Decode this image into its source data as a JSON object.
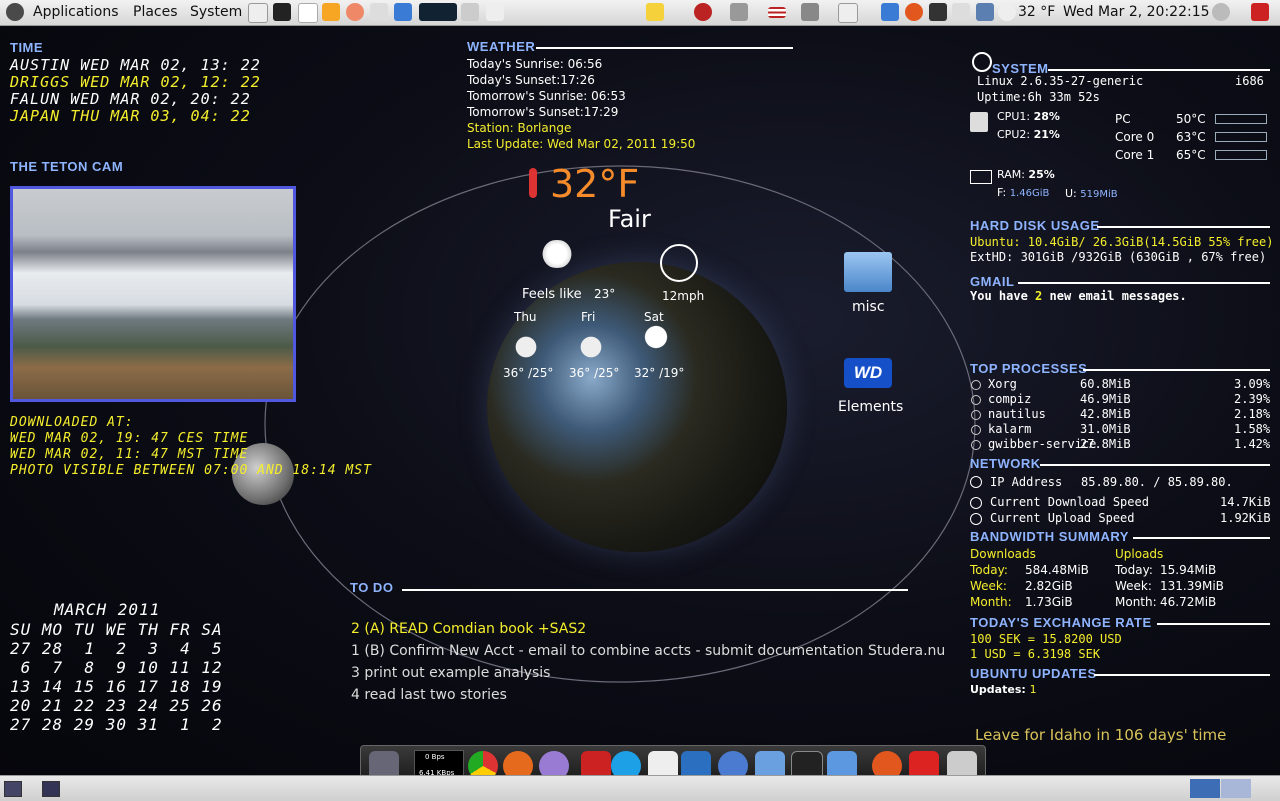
{
  "top_panel": {
    "menus": [
      "Applications",
      "Places",
      "System"
    ],
    "temperature": "32 °F",
    "clock": "Wed Mar  2, 20:22:15"
  },
  "time_widget": {
    "title": "TIME",
    "rows": [
      {
        "city": "AUSTIN",
        "time": "WED MAR 02, 13: 22"
      },
      {
        "city": "DRIGGS",
        "time": "WED MAR 02, 12: 22"
      },
      {
        "city": "FALUN",
        "time": "WED MAR 02, 20: 22"
      },
      {
        "city": "JAPAN",
        "time": "THU MAR 03, 04: 22"
      }
    ]
  },
  "cam_widget": {
    "title": "THE TETON CAM",
    "downloaded_label": "DOWNLOADED AT:",
    "line1": "WED MAR 02, 19: 47 CES TIME",
    "line2": "WED MAR 02, 11: 47 MST TIME",
    "line3": "PHOTO VISIBLE BETWEEN 07:00 AND 18:14 MST"
  },
  "calendar": {
    "title": "MARCH 2011",
    "header": "SU MO TU WE TH FR SA",
    "weeks": [
      "27 28  1  2  3  4  5",
      " 6  7  8  9 10 11 12",
      "13 14 15 16 17 18 19",
      "20 21 22 23 24 25 26",
      "27 28 29 30 31  1  2"
    ]
  },
  "weather": {
    "title": "WEATHER",
    "sunrise_today": "Today's Sunrise: 06:56",
    "sunset_today": "Today's Sunset:17:26",
    "sunrise_tomorrow": "Tomorrow's Sunrise: 06:53",
    "sunset_tomorrow": "Tomorrow's Sunset:17:29",
    "station": "Station: Borlange",
    "last_update": "Last Update: Wed Mar 02, 2011 19:50",
    "temp": "32°F",
    "condition": "Fair",
    "feels_like_label": "Feels like",
    "feels_like_value": "23°",
    "wind": "12mph",
    "forecast": [
      {
        "day": "Thu",
        "temps": "36° /25°"
      },
      {
        "day": "Fri",
        "temps": "36° /25°"
      },
      {
        "day": "Sat",
        "temps": "32° /19°"
      }
    ]
  },
  "desktop_icons": {
    "misc": "misc",
    "elements": "Elements",
    "wd_logo": "WD"
  },
  "todo": {
    "title": "TO DO",
    "items": [
      "2 (A) READ Comdian book +SAS2",
      "1 (B) Confirm New Acct - email to combine accts - submit documentation Studera.nu",
      "3 print out example analysis",
      "4 read last two stories"
    ]
  },
  "system": {
    "title": "SYSTEM",
    "kernel": "Linux 2.6.35-27-generic",
    "arch": "i686",
    "uptime": "Uptime:6h 33m 52s",
    "cpu1_label": "CPU1:",
    "cpu1": "28%",
    "cpu2_label": "CPU2:",
    "cpu2": "21%",
    "temps": [
      {
        "label": "PC",
        "value": "50°C"
      },
      {
        "label": "Core 0",
        "value": "63°C"
      },
      {
        "label": "Core 1",
        "value": "65°C"
      }
    ],
    "ram_label": "RAM:",
    "ram": "25%",
    "free_label": "F:",
    "free": "1.46GiB",
    "used_label": "U:",
    "used": "519MiB"
  },
  "disk": {
    "title": "HARD DISK USAGE",
    "ubuntu": "Ubuntu: 10.4GiB/ 26.3GiB(14.5GiB 55% free)",
    "exthd": "ExtHD: 301GiB /932GiB  (630GiB , 67% free)"
  },
  "gmail": {
    "title": "GMAIL",
    "prefix": "You have ",
    "count": "2",
    "suffix": " new email messages."
  },
  "processes": {
    "title": "TOP PROCESSES",
    "rows": [
      {
        "name": "Xorg",
        "mem": "60.8MiB",
        "cpu": "3.09%"
      },
      {
        "name": "compiz",
        "mem": "46.9MiB",
        "cpu": "2.39%"
      },
      {
        "name": "nautilus",
        "mem": "42.8MiB",
        "cpu": "2.18%"
      },
      {
        "name": "kalarm",
        "mem": "31.0MiB",
        "cpu": "1.58%"
      },
      {
        "name": "gwibber-service",
        "mem": "27.8MiB",
        "cpu": "1.42%"
      }
    ]
  },
  "network": {
    "title": "NETWORK",
    "ip_label": "IP Address",
    "ip_value": "85.89.80.  / 85.89.80.",
    "down_label": "Current Download Speed",
    "down_value": "14.7KiB",
    "up_label": "Current Upload Speed",
    "up_value": "1.92KiB"
  },
  "bandwidth": {
    "title": "BANDWIDTH SUMMARY",
    "downloads_label": "Downloads",
    "uploads_label": "Uploads",
    "rows": [
      {
        "label": "Today:",
        "down": "584.48MiB",
        "up_label": "Today:",
        "up": "15.94MiB"
      },
      {
        "label": "Week:",
        "down": "2.82GiB",
        "up_label": "Week:",
        "up": "131.39MiB"
      },
      {
        "label": "Month:",
        "down": "1.73GiB",
        "up_label": "Month:",
        "up": "46.72MiB"
      }
    ]
  },
  "exchange": {
    "title": "TODAY'S EXCHANGE RATE",
    "line1": "100 SEK = 15.8200 USD",
    "line2": "1 USD = 6.3198 SEK"
  },
  "updates": {
    "title": "UBUNTU UPDATES",
    "label": "Updates:",
    "value": "1"
  },
  "countdown": "Leave for Idaho in 106 days' time",
  "dock": {
    "net_top": "0 Bps",
    "net_mid": "6.41 KBps"
  }
}
